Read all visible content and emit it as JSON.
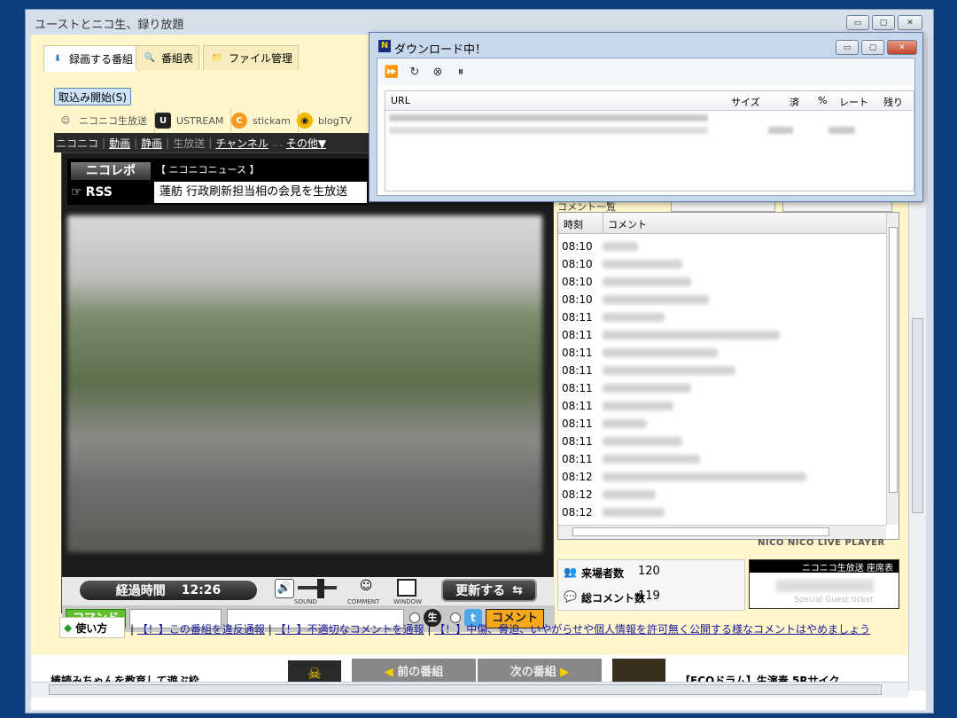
{
  "main_window": {
    "title": "ユーストとニコ生、録り放題",
    "caption_buttons": {
      "minimize": "▭",
      "maximize": "▢",
      "close": "✕"
    }
  },
  "tabs": [
    {
      "label": "録画する番組",
      "icon": "url-download-icon"
    },
    {
      "label": "番組表",
      "icon": "magnifier-icon"
    },
    {
      "label": "ファイル管理",
      "icon": "folder-icon"
    }
  ],
  "load_button": "取込み開始(S)",
  "services": [
    {
      "label": "ニコニコ生放送",
      "icon": "niconico-icon"
    },
    {
      "label": "USTREAM",
      "icon": "ustream-icon"
    },
    {
      "label": "stickam",
      "icon": "stickam-icon"
    },
    {
      "label": "blogTV",
      "icon": "blogtv-icon"
    }
  ],
  "nico_nav": {
    "brand": "ニコニコ",
    "links": [
      "動画",
      "静画",
      "生放送",
      "チャンネル",
      "その他▼"
    ]
  },
  "player": {
    "nicorepo": {
      "logo": "ニコレポ",
      "rss": "RSS",
      "source": "【 ニコニコニュース 】",
      "headline": "蓮舫 行政刷新担当相の会見を生放送"
    },
    "elapsed_label": "経過時間",
    "elapsed_value": "12:26",
    "sound_label": "SOUND",
    "comment_label": "COMMENT",
    "window_label": "WINDOW",
    "refresh_label": "更新する",
    "command_label": "コマンド",
    "live_mark": "生",
    "comment_button": "コメント"
  },
  "comment_panel": {
    "list_label": "コメント一覧",
    "col_time": "時刻",
    "col_comment": "コメント",
    "times": [
      "08:10",
      "08:10",
      "08:10",
      "08:10",
      "08:11",
      "08:11",
      "08:11",
      "08:11",
      "08:11",
      "08:11",
      "08:11",
      "08:11",
      "08:11",
      "08:12",
      "08:12",
      "08:12"
    ],
    "footer": "NICO NICO LIVE PLAYER"
  },
  "stats": {
    "visitors_label": "来場者数",
    "visitors_value": "120",
    "comments_label": "総コメント数",
    "comments_value": "119"
  },
  "ticket": {
    "title": "ニコニコ生放送 座席表",
    "subtitle": "Special Guest ticket"
  },
  "howto_label": "使い方",
  "notices": [
    "【！】この番組を違反通報",
    "【！】不適切なコメントを通報",
    "【！】中傷、脅迫、いやがらせや個人情報を許可無く公開する様なコメントはやめましょう"
  ],
  "bottom_strip": {
    "left_text": "棒読みちゃんを教育して遊ぶ枠",
    "prev_label": "前の番組",
    "next_label": "次の番組",
    "right_text": "【ECOドラム】生演奏 5Rサイク..."
  },
  "download_window": {
    "title": "ダウンロード中！",
    "columns": [
      "URL",
      "サイズ",
      "済",
      "%",
      "レート",
      "残り"
    ]
  }
}
